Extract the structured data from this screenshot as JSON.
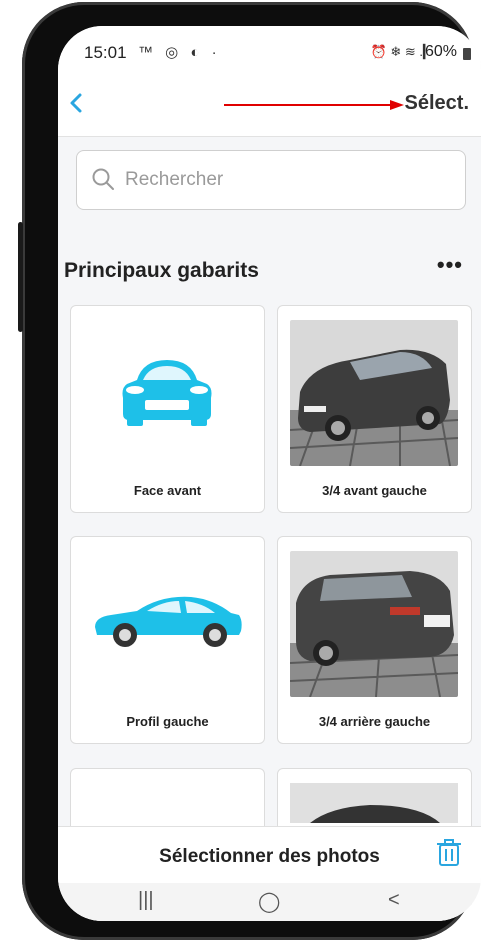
{
  "status_bar": {
    "time": "15:01",
    "left_icons": "™ ◎ ◐ ·",
    "right_icons": "⏰ ❄ ≋ .▎",
    "battery": "60%"
  },
  "navbar": {
    "back_icon": "chevron-left-icon",
    "select_label": "Sélect."
  },
  "search": {
    "placeholder": "Rechercher"
  },
  "section": {
    "title": "Principaux gabarits",
    "more": "•••"
  },
  "templates": [
    {
      "label": "Face avant"
    },
    {
      "label": "3/4 avant gauche"
    },
    {
      "label": "Profil gauche"
    },
    {
      "label": "3/4 arrière gauche"
    }
  ],
  "bottom_bar": {
    "label": "Sélectionner des photos",
    "trash_icon": "trash-icon"
  },
  "system_nav": {
    "recents": "|||",
    "home": "◯",
    "back": "<"
  },
  "colors": {
    "accent": "#2aa6e0",
    "car_blue": "#1ec0e8",
    "annotation_arrow": "#e00000"
  }
}
